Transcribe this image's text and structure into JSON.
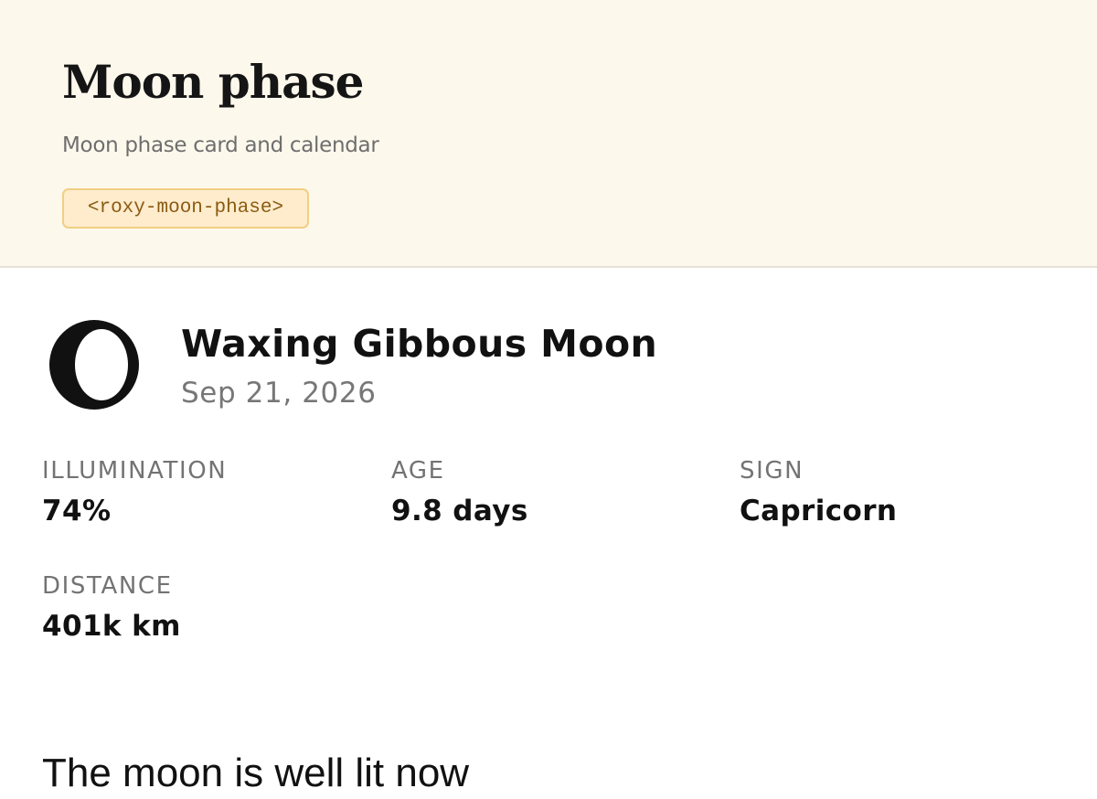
{
  "header": {
    "title": "Moon phase",
    "subtitle": "Moon phase card and calendar",
    "component_tag": "<roxy-moon-phase>"
  },
  "moon_card": {
    "phase_icon": "waxing-gibbous-moon-icon",
    "phase_name": "Waxing Gibbous Moon",
    "date": "Sep 21, 2026",
    "stats": {
      "illumination": {
        "label": "ILLUMINATION",
        "value": "74%"
      },
      "age": {
        "label": "AGE",
        "value": "9.8 days"
      },
      "sign": {
        "label": "SIGN",
        "value": "Capricorn"
      },
      "distance": {
        "label": "DISTANCE",
        "value": "401k km"
      }
    },
    "description": "The moon is well lit now"
  },
  "colors": {
    "header_background": "#fdf8ec",
    "tag_background": "#feeccd",
    "tag_border": "#f1cf82",
    "tag_text": "#8b5a12",
    "muted_text": "#777777"
  }
}
